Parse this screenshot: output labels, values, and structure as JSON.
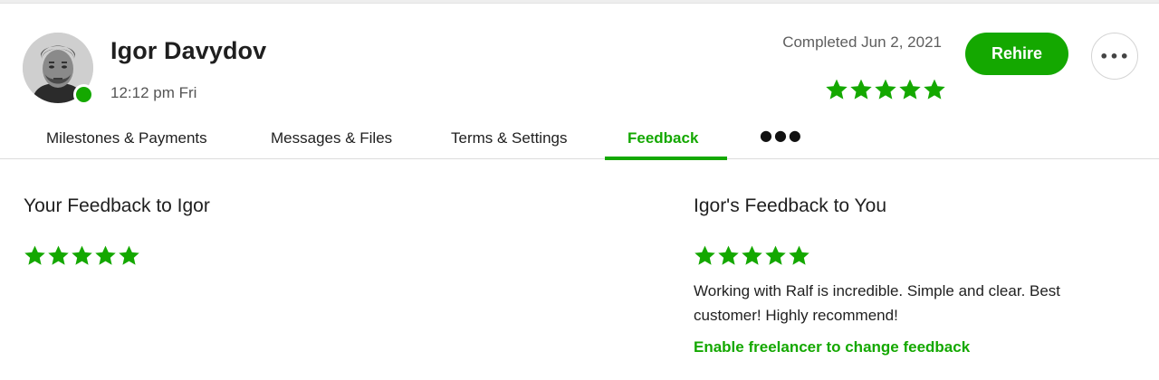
{
  "header": {
    "name": "Igor Davydov",
    "local_time": "12:12 pm Fri",
    "status": "Completed Jun 2, 2021",
    "rating": 5,
    "rehire_label": "Rehire",
    "more_icon": "ellipsis-icon",
    "more_label": "•••",
    "online_color": "#14a800"
  },
  "tabs": [
    {
      "label": "Milestones & Payments",
      "active": false
    },
    {
      "label": "Messages & Files",
      "active": false
    },
    {
      "label": "Terms & Settings",
      "active": false
    },
    {
      "label": "Feedback",
      "active": true
    }
  ],
  "tabs_more_label": "●●●",
  "feedback_to_freelancer": {
    "title": "Your Feedback to Igor",
    "rating": 5
  },
  "feedback_from_freelancer": {
    "title": "Igor's Feedback to You",
    "rating": 5,
    "comment": "Working with Ralf is incredible. Simple and clear. Best customer! Highly recommend!",
    "link_label": "Enable freelancer to change feedback"
  },
  "colors": {
    "accent": "#14a800",
    "text": "#1f1f1f",
    "muted": "#5e5e5e"
  }
}
